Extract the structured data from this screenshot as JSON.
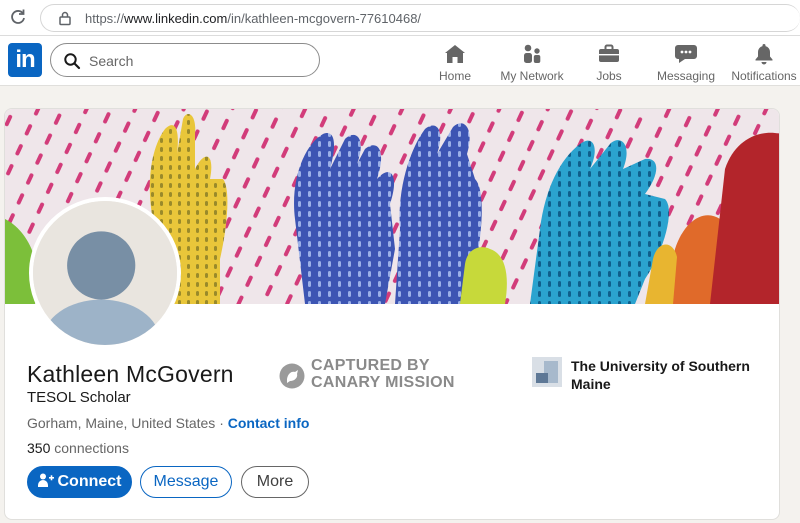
{
  "browser": {
    "url_prefix": "https://",
    "url_host": "www.linkedin.com",
    "url_path": "/in/kathleen-mcgovern-77610468/"
  },
  "nav": {
    "logo": "in",
    "search_placeholder": "Search",
    "items": [
      {
        "label": "Home",
        "icon": "home-icon"
      },
      {
        "label": "My Network",
        "icon": "network-icon"
      },
      {
        "label": "Jobs",
        "icon": "briefcase-icon"
      },
      {
        "label": "Messaging",
        "icon": "message-icon"
      },
      {
        "label": "Notifications",
        "icon": "bell-icon"
      }
    ]
  },
  "profile": {
    "name": "Kathleen McGovern",
    "headline": "TESOL Scholar",
    "location": "Gorham, Maine, United States",
    "separator": " · ",
    "contact_label": "Contact info",
    "connections_count": "350",
    "connections_label": " connections",
    "school": "The University of Southern Maine"
  },
  "actions": {
    "connect": "Connect",
    "message": "Message",
    "more": "More"
  },
  "watermark": {
    "line1": "CAPTURED BY",
    "line2": "CANARY MISSION"
  },
  "colors": {
    "brand": "#0a66c2",
    "page_bg": "#f4f2ee"
  }
}
